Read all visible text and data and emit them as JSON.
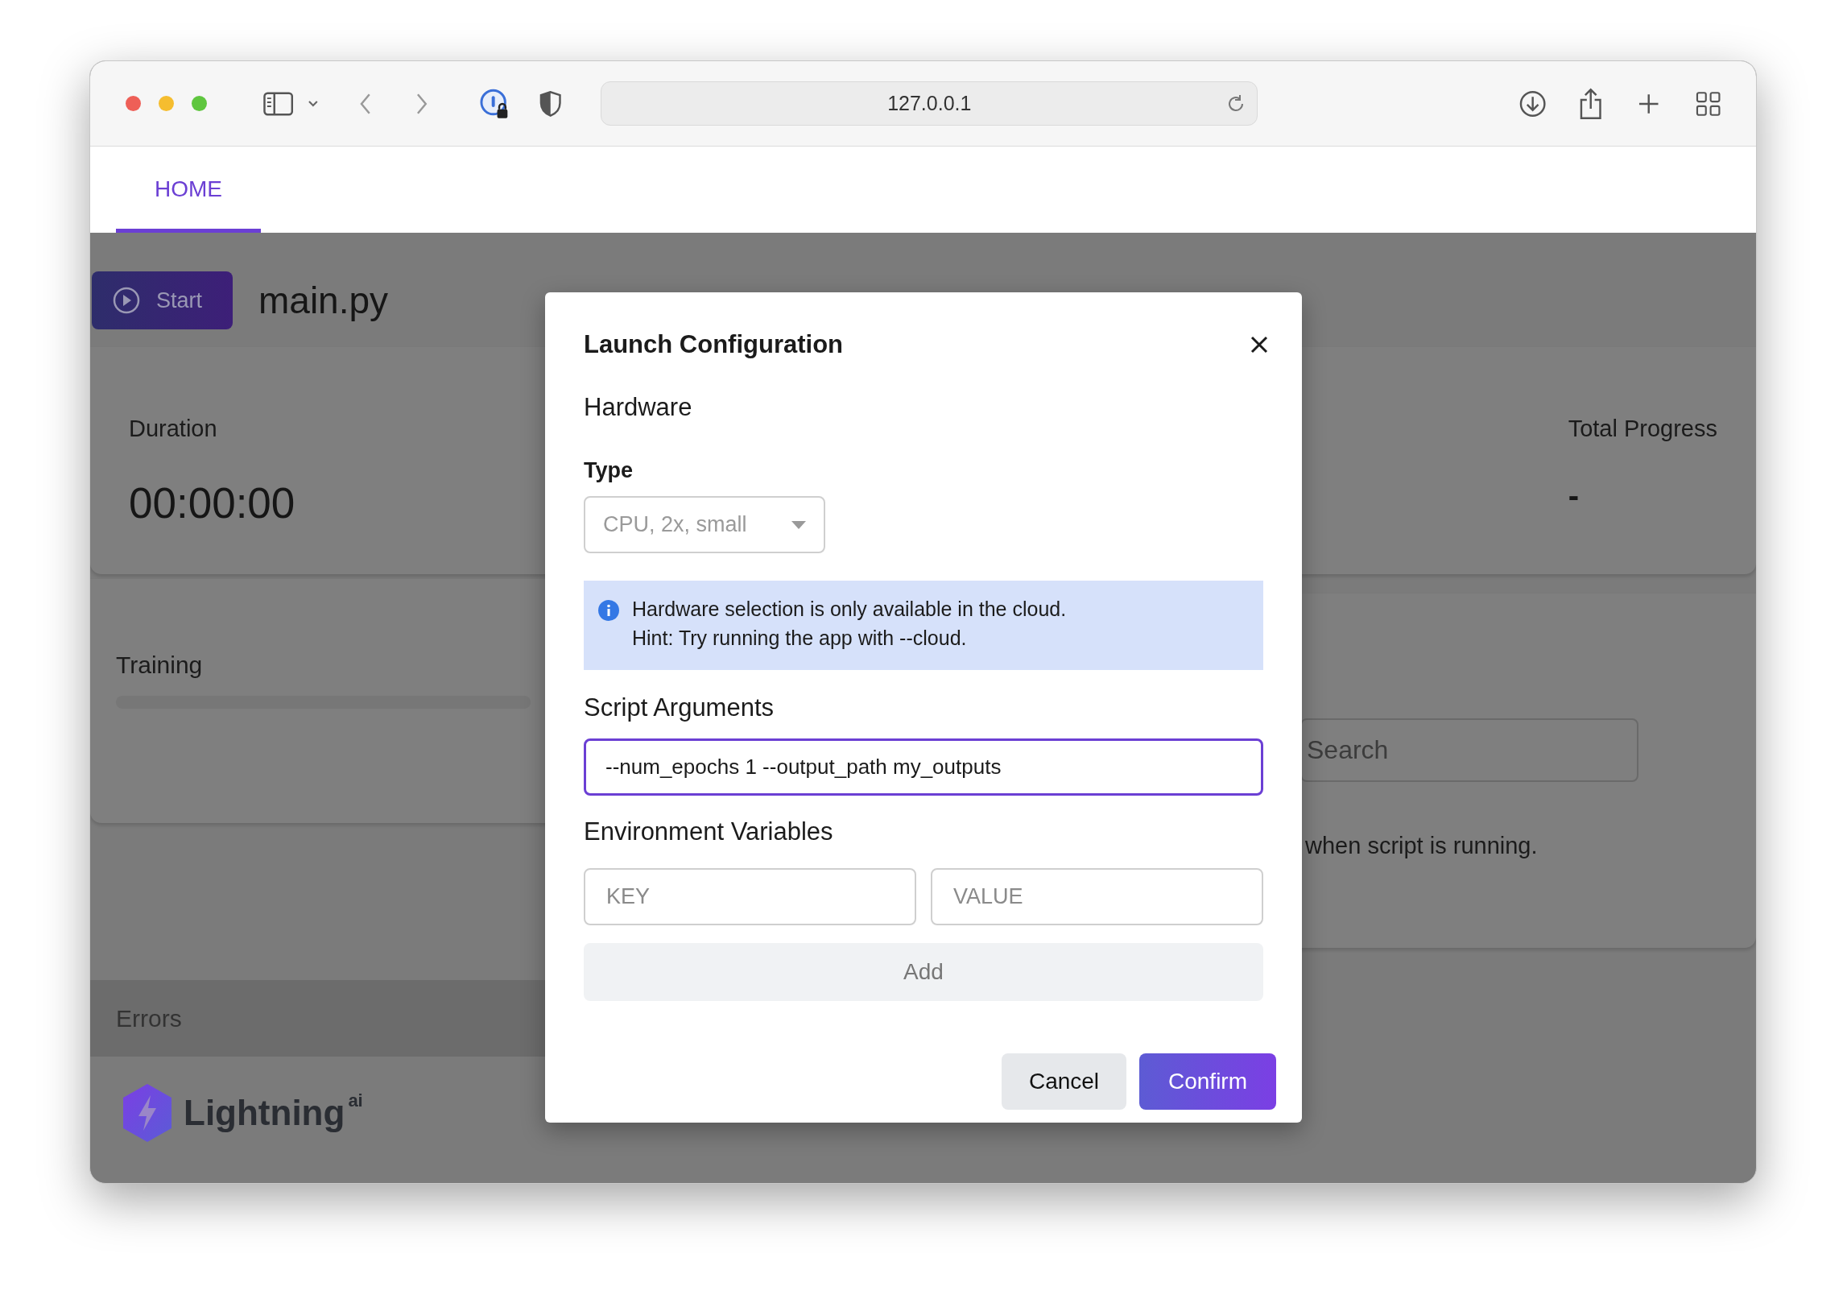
{
  "browser": {
    "url": "127.0.0.1"
  },
  "tabs": [
    {
      "label": "HOME",
      "selected": true
    }
  ],
  "page": {
    "start_button": "Start",
    "script_name": "main.py",
    "stats": [
      {
        "label": "Duration",
        "value": "00:00:00"
      },
      {
        "label": "Total Progress",
        "value": "-"
      }
    ],
    "training": {
      "title": "Training"
    },
    "logs": {
      "search_placeholder": "Search",
      "message": "when script is running."
    },
    "errors": {
      "title": "Errors"
    },
    "logo": {
      "text": "Lightning",
      "suffix": "ai"
    }
  },
  "dialog": {
    "title": "Launch Configuration",
    "hardware": {
      "heading": "Hardware",
      "type_label": "Type",
      "select": {
        "value": "CPU, 2x, small",
        "disabled": true
      },
      "notice": [
        "Hardware selection is only available in the cloud.",
        "Hint: Try running the app with --cloud."
      ]
    },
    "script_arguments": {
      "heading": "Script Arguments",
      "value": "--num_epochs 1 --output_path my_outputs",
      "focused": true
    },
    "environment_variables": {
      "heading": "Environment Variables",
      "key_placeholder": "KEY",
      "value_placeholder": "VALUE",
      "add_button": {
        "label": "Add",
        "disabled": true
      }
    },
    "buttons": [
      {
        "label": "Cancel",
        "kind": "secondary"
      },
      {
        "label": "Confirm",
        "kind": "primary"
      }
    ]
  }
}
